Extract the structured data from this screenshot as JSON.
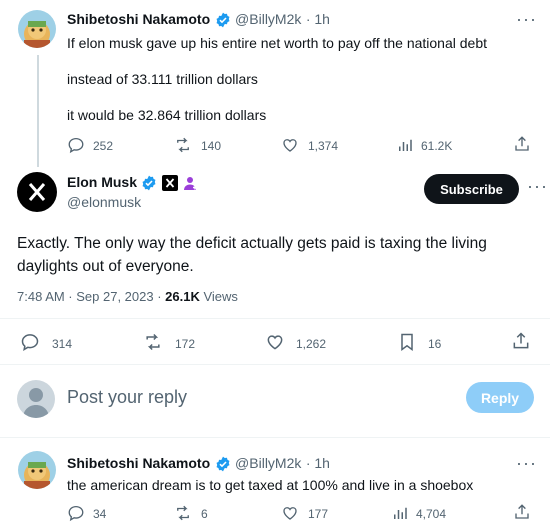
{
  "parent_tweet": {
    "name": "Shibetoshi Nakamoto",
    "handle": "@BillyM2k",
    "time": "· 1h",
    "lines": [
      "If elon musk gave up his entire net worth to pay off the national debt",
      "instead of 33.111 trillion dollars",
      "it would be 32.864 trillion dollars"
    ],
    "replies": "252",
    "reposts": "140",
    "likes": "1,374",
    "views": "61.2K"
  },
  "main_tweet": {
    "name": "Elon Musk",
    "handle": "@elonmusk",
    "subscribe_label": "Subscribe",
    "text_line1": "Exactly. The only way the deficit actually gets paid is taxing the living",
    "text_line2": "daylights out of everyone.",
    "timestamp": "7:48 AM · Sep 27, 2023 · ",
    "views_count": "26.1K",
    "views_label": " Views",
    "replies": "314",
    "reposts": "172",
    "likes": "1,262",
    "bookmarks": "16"
  },
  "composer": {
    "placeholder": "Post your reply",
    "reply_label": "Reply"
  },
  "reply_tweet": {
    "name": "Shibetoshi Nakamoto",
    "handle": "@BillyM2k",
    "time": "· 1h",
    "text": "the american dream is to get taxed at 100% and live in a shoebox",
    "replies": "34",
    "reposts": "6",
    "likes": "177",
    "views": "4,704"
  },
  "colors": {
    "verified": "#1d9bf0",
    "muted": "#536471",
    "reply_button": "#8ecdf8",
    "subscribe_button": "#0f1419"
  }
}
